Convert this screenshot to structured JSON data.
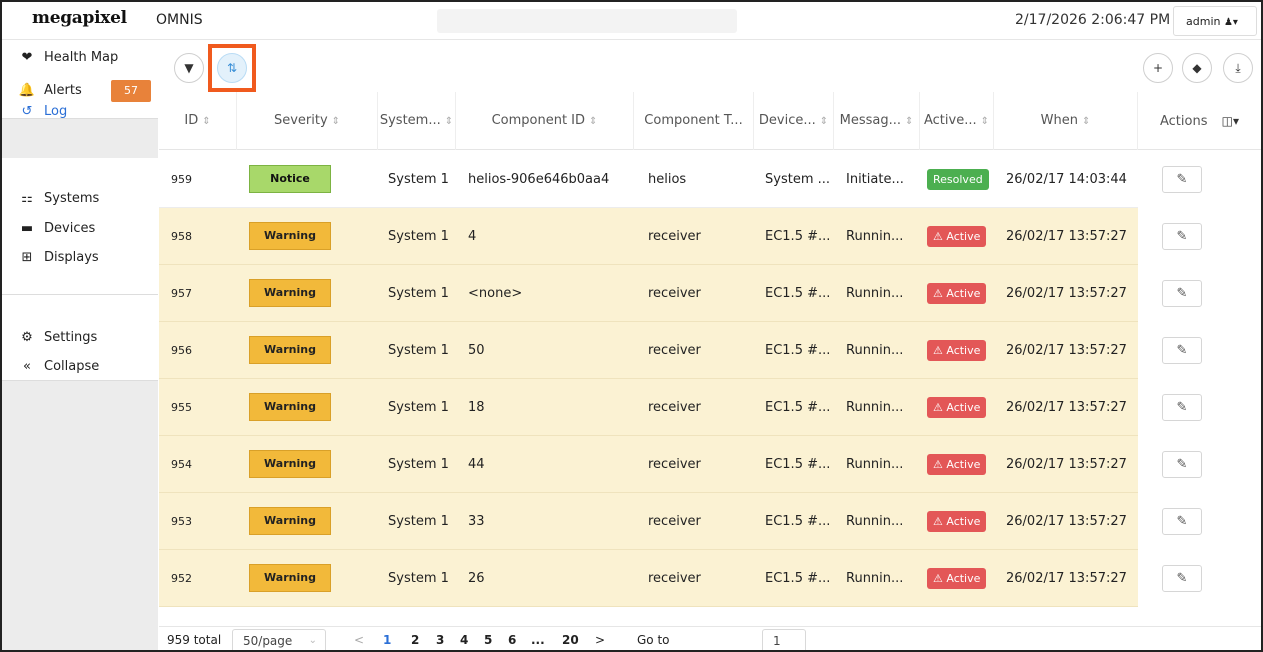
{
  "header": {
    "logo": "megapixel",
    "app_title": "OMNIS",
    "datetime": "2/17/2026 2:06:47 PM",
    "user": "admin",
    "user_icon": "user-dropdown-icon"
  },
  "sidebar": {
    "items": [
      {
        "label": "Health Map",
        "icon": "heart-pulse-icon"
      },
      {
        "label": "Alerts",
        "icon": "bell-icon",
        "badge": "57"
      },
      {
        "label": "Log",
        "icon": "history-icon"
      },
      {
        "label": "Systems",
        "icon": "network-icon"
      },
      {
        "label": "Devices",
        "icon": "device-icon"
      },
      {
        "label": "Displays",
        "icon": "grid-icon"
      },
      {
        "label": "Settings",
        "icon": "gears-icon"
      },
      {
        "label": "Collapse",
        "icon": "double-chevron-left-icon"
      }
    ]
  },
  "table": {
    "columns": [
      "ID",
      "Severity",
      "System...",
      "Component ID",
      "Component T...",
      "Device...",
      "Messag...",
      "Active...",
      "When",
      "Actions"
    ],
    "rows": [
      {
        "id": "959",
        "severity": "Notice",
        "system": "System 1",
        "component_id": "helios-906e646b0aa4",
        "component_type": "helios",
        "device": "System ...",
        "message": "Initiate...",
        "active": "Resolved",
        "when": "26/02/17 14:03:44"
      },
      {
        "id": "958",
        "severity": "Warning",
        "system": "System 1",
        "component_id": "4",
        "component_type": "receiver",
        "device": "EC1.5 #...",
        "message": "Runnin...",
        "active": "Active",
        "when": "26/02/17 13:57:27"
      },
      {
        "id": "957",
        "severity": "Warning",
        "system": "System 1",
        "component_id": "<none>",
        "component_type": "receiver",
        "device": "EC1.5 #...",
        "message": "Runnin...",
        "active": "Active",
        "when": "26/02/17 13:57:27"
      },
      {
        "id": "956",
        "severity": "Warning",
        "system": "System 1",
        "component_id": "50",
        "component_type": "receiver",
        "device": "EC1.5 #...",
        "message": "Runnin...",
        "active": "Active",
        "when": "26/02/17 13:57:27"
      },
      {
        "id": "955",
        "severity": "Warning",
        "system": "System 1",
        "component_id": "18",
        "component_type": "receiver",
        "device": "EC1.5 #...",
        "message": "Runnin...",
        "active": "Active",
        "when": "26/02/17 13:57:27"
      },
      {
        "id": "954",
        "severity": "Warning",
        "system": "System 1",
        "component_id": "44",
        "component_type": "receiver",
        "device": "EC1.5 #...",
        "message": "Runnin...",
        "active": "Active",
        "when": "26/02/17 13:57:27"
      },
      {
        "id": "953",
        "severity": "Warning",
        "system": "System 1",
        "component_id": "33",
        "component_type": "receiver",
        "device": "EC1.5 #...",
        "message": "Runnin...",
        "active": "Active",
        "when": "26/02/17 13:57:27"
      },
      {
        "id": "952",
        "severity": "Warning",
        "system": "System 1",
        "component_id": "26",
        "component_type": "receiver",
        "device": "EC1.5 #...",
        "message": "Runnin...",
        "active": "Active",
        "when": "26/02/17 13:57:27"
      }
    ]
  },
  "pagination": {
    "total": "959 total",
    "page_size": "50/page",
    "pages": [
      "1",
      "2",
      "3",
      "4",
      "5",
      "6",
      "...",
      "20"
    ],
    "current_page": "1",
    "goto_label": "Go to",
    "goto_value": "1"
  },
  "colors": {
    "accent": "#2b6fd6",
    "warning": "#f2b93a",
    "notice": "#a8d86a",
    "active_status": "#e35757",
    "resolved_status": "#4caf50",
    "highlight": "#f05a1e",
    "alert_badge": "#e8823a"
  }
}
